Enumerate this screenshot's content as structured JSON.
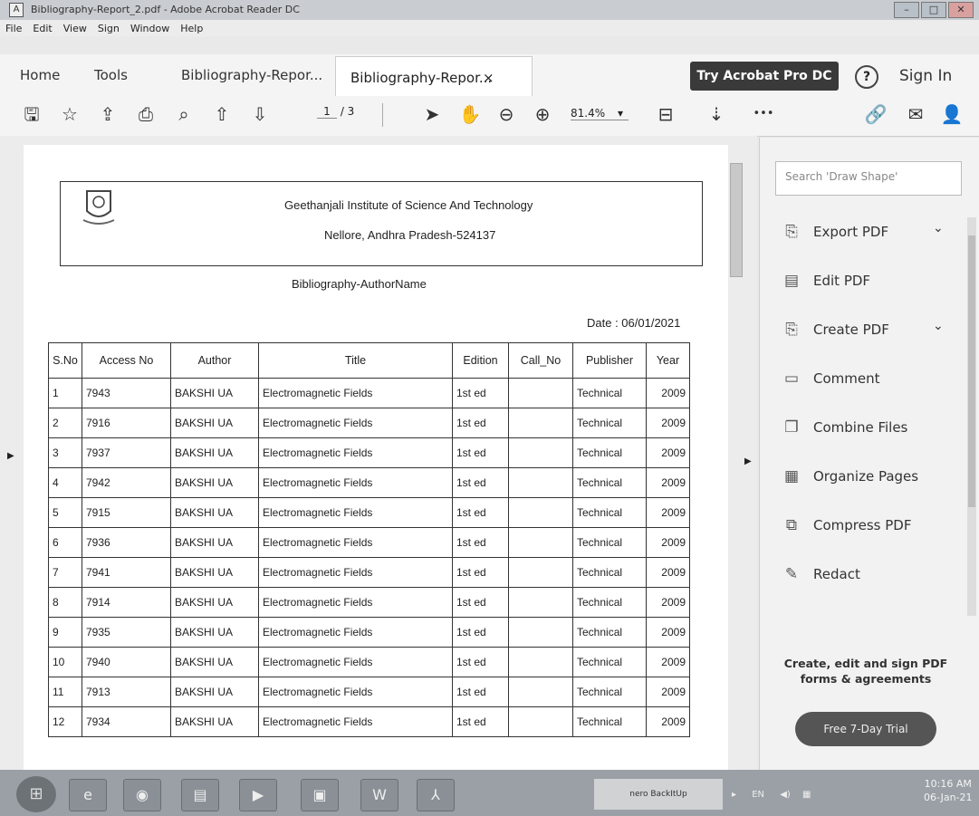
{
  "window": {
    "title": "Bibliography-Report_2.pdf - Adobe Acrobat Reader DC",
    "app_icon": "acrobat-icon",
    "controls": [
      "–",
      "□",
      "✕"
    ]
  },
  "menu": [
    "File",
    "Edit",
    "View",
    "Sign",
    "Window",
    "Help"
  ],
  "tabs": {
    "home": "Home",
    "tools": "Tools",
    "tab1": "Bibliography-Repor...",
    "tab2": "Bibliography-Repor...",
    "tab2_close": "×"
  },
  "header_actions": {
    "try_pro": "Try Acrobat Pro DC",
    "help": "?",
    "sign_in": "Sign In"
  },
  "toolbar": {
    "current_page": "1",
    "total_pages": "/ 3",
    "zoom": "81.4%",
    "zoom_arrow": "▾",
    "more": "•••"
  },
  "document": {
    "institute": "Geethanjali Institute of Science And Technology",
    "address": "Nellore, Andhra Pradesh-524137",
    "report_title": "Bibliography-AuthorName",
    "date": "Date : 06/01/2021",
    "columns": [
      "S.No",
      "Access No",
      "Author",
      "Title",
      "Edition",
      "Call_No",
      "Publisher",
      "Year"
    ],
    "rows": [
      [
        "1",
        "7943",
        "BAKSHI UA",
        "Electromagnetic Fields",
        "1st ed",
        "",
        "Technical",
        "2009"
      ],
      [
        "2",
        "7916",
        "BAKSHI UA",
        "Electromagnetic Fields",
        "1st ed",
        "",
        "Technical",
        "2009"
      ],
      [
        "3",
        "7937",
        "BAKSHI UA",
        "Electromagnetic Fields",
        "1st ed",
        "",
        "Technical",
        "2009"
      ],
      [
        "4",
        "7942",
        "BAKSHI UA",
        "Electromagnetic Fields",
        "1st ed",
        "",
        "Technical",
        "2009"
      ],
      [
        "5",
        "7915",
        "BAKSHI UA",
        "Electromagnetic Fields",
        "1st ed",
        "",
        "Technical",
        "2009"
      ],
      [
        "6",
        "7936",
        "BAKSHI UA",
        "Electromagnetic Fields",
        "1st ed",
        "",
        "Technical",
        "2009"
      ],
      [
        "7",
        "7941",
        "BAKSHI UA",
        "Electromagnetic Fields",
        "1st ed",
        "",
        "Technical",
        "2009"
      ],
      [
        "8",
        "7914",
        "BAKSHI UA",
        "Electromagnetic Fields",
        "1st ed",
        "",
        "Technical",
        "2009"
      ],
      [
        "9",
        "7935",
        "BAKSHI UA",
        "Electromagnetic Fields",
        "1st ed",
        "",
        "Technical",
        "2009"
      ],
      [
        "10",
        "7940",
        "BAKSHI UA",
        "Electromagnetic Fields",
        "1st ed",
        "",
        "Technical",
        "2009"
      ],
      [
        "11",
        "7913",
        "BAKSHI UA",
        "Electromagnetic Fields",
        "1st ed",
        "",
        "Technical",
        "2009"
      ],
      [
        "12",
        "7934",
        "BAKSHI UA",
        "Electromagnetic Fields",
        "1st ed",
        "",
        "Technical",
        "2009"
      ]
    ]
  },
  "right_pane": {
    "search_placeholder": "Search 'Draw Shape'",
    "items": [
      {
        "label": "Export PDF",
        "icon": "export-pdf-icon",
        "chevron": "⌄"
      },
      {
        "label": "Edit PDF",
        "icon": "edit-pdf-icon",
        "chevron": ""
      },
      {
        "label": "Create PDF",
        "icon": "create-pdf-icon",
        "chevron": "⌄"
      },
      {
        "label": "Comment",
        "icon": "comment-icon",
        "chevron": ""
      },
      {
        "label": "Combine Files",
        "icon": "combine-files-icon",
        "chevron": ""
      },
      {
        "label": "Organize Pages",
        "icon": "organize-pages-icon",
        "chevron": ""
      },
      {
        "label": "Compress PDF",
        "icon": "compress-pdf-icon",
        "chevron": ""
      },
      {
        "label": "Redact",
        "icon": "redact-icon",
        "chevron": ""
      }
    ],
    "promo": "Create, edit and sign PDF forms & agreements",
    "trial_button": "Free 7-Day Trial"
  },
  "taskbar": {
    "nero": "nero BackItUp",
    "lang": "EN",
    "time": "10:16 AM",
    "date": "06-Jan-21"
  },
  "colors": {
    "try_button_bg": "#3a3a3a",
    "trial_button_bg": "#555555",
    "taskbar_bg": "#9aa0a6"
  }
}
